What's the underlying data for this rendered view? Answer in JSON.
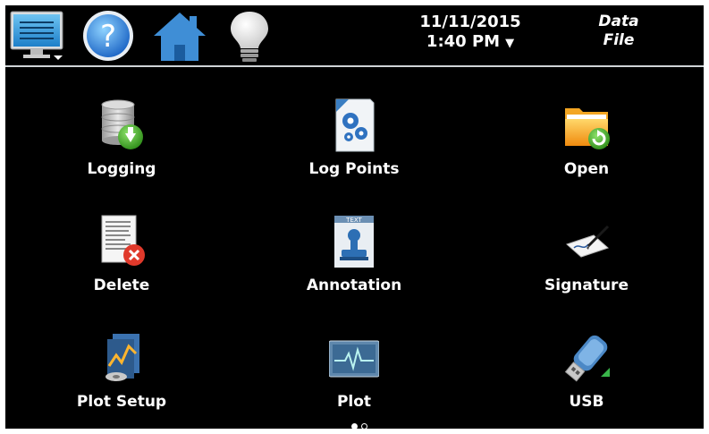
{
  "header": {
    "menu_icon": "monitor-menu-icon",
    "help_icon": "question-help-icon",
    "home_icon": "home-icon",
    "light_icon": "lightbulb-icon",
    "date": "11/11/2015",
    "time": "1:40 PM",
    "time_dropdown": "▼",
    "title_line1": "Data",
    "title_line2": "File"
  },
  "tiles": [
    {
      "label": "Logging",
      "icon": "database-download-icon"
    },
    {
      "label": "Log Points",
      "icon": "gear-document-icon"
    },
    {
      "label": "Open",
      "icon": "folder-refresh-icon"
    },
    {
      "label": "Delete",
      "icon": "document-delete-icon"
    },
    {
      "label": "Annotation",
      "icon": "stamp-text-icon"
    },
    {
      "label": "Signature",
      "icon": "pen-signature-icon"
    },
    {
      "label": "Plot Setup",
      "icon": "chart-box-icon"
    },
    {
      "label": "Plot",
      "icon": "waveform-monitor-icon"
    },
    {
      "label": "USB",
      "icon": "usb-drive-icon"
    }
  ],
  "pagination": {
    "current": 1,
    "total": 2
  }
}
